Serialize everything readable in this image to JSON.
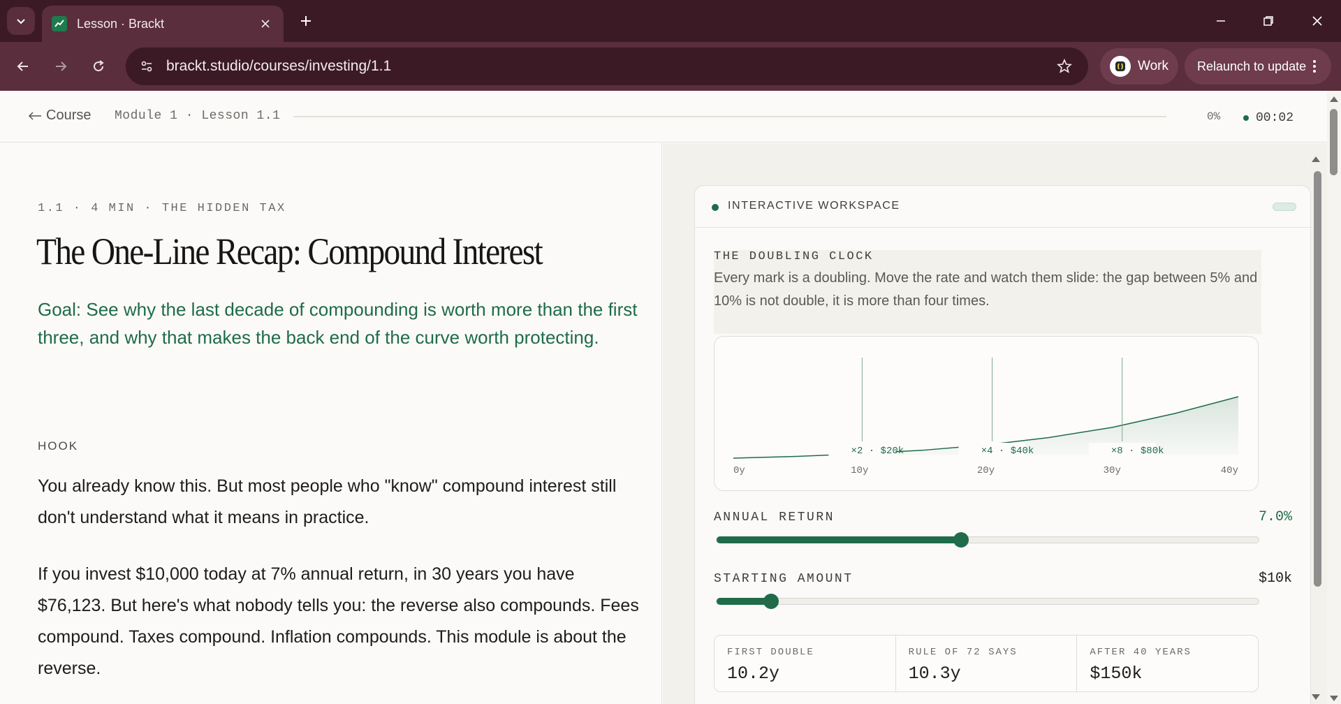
{
  "browser": {
    "tab_title": "Lesson · Brackt",
    "url": "brackt.studio/courses/investing/1.1",
    "profile_label": "Work",
    "relaunch_label": "Relaunch to update"
  },
  "header": {
    "back_label": "Course",
    "breadcrumb": "Module 1 · Lesson 1.1",
    "progress_percent": 0,
    "progress_label": "0%",
    "timer": "00:02"
  },
  "lesson": {
    "eyebrow": "1.1 · 4 MIN · THE HIDDEN TAX",
    "title": "The One-Line Recap: Compound Interest",
    "goal": "Goal: See why the last decade of compounding is worth more than the first three, and why that makes the back end of the curve worth protecting.",
    "hook_label": "HOOK",
    "paragraphs": [
      "You already know this. But most people who \"know\" compound interest still don't understand what it means in practice.",
      "If you invest $10,000 today at 7% annual return, in 30 years you have $76,123. But here's what nobody tells you: the reverse also compounds. Fees compound. Taxes compound. Inflation compounds. This module is about the reverse."
    ]
  },
  "workspace": {
    "title": "INTERACTIVE WORKSPACE",
    "clock_title": "THE DOUBLING CLOCK",
    "clock_desc": "Every mark is a doubling. Move the rate and watch them slide: the gap between 5% and 10% is not double, it is more than four times.",
    "annual_return_label": "ANNUAL RETURN",
    "annual_return_value": "7.0%",
    "annual_return_fraction": 0.45,
    "starting_amount_label": "STARTING AMOUNT",
    "starting_amount_value": "$10k",
    "starting_amount_fraction": 0.1,
    "stats": [
      {
        "label": "FIRST DOUBLE",
        "value": "10.2y"
      },
      {
        "label": "RULE OF 72 SAYS",
        "value": "10.3y"
      },
      {
        "label": "AFTER 40 YEARS",
        "value": "$150k"
      }
    ]
  },
  "chart_data": {
    "type": "area",
    "x_ticks": [
      "0y",
      "10y",
      "20y",
      "30y",
      "40y"
    ],
    "xlim": [
      0,
      40
    ],
    "x": [
      0,
      5,
      10,
      15,
      20,
      25,
      30,
      35,
      40
    ],
    "y": [
      10,
      14,
      20,
      28,
      40,
      57,
      80,
      112,
      150
    ],
    "markers": [
      {
        "x": 10.2,
        "label": "×2 · $20k"
      },
      {
        "x": 20.5,
        "label": "×4 · $40k"
      },
      {
        "x": 30.8,
        "label": "×8 · $80k"
      }
    ]
  },
  "colors": {
    "accent": "#1f6b4a",
    "chrome": "#3b1a26"
  }
}
